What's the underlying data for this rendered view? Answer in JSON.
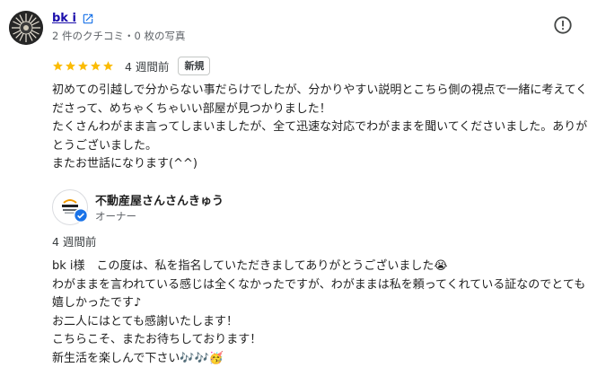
{
  "review": {
    "reviewer_name": "bk i",
    "reviewer_meta": "2 件のクチコミ・0 枚の写真",
    "rating": 5,
    "date": "4 週間前",
    "badge": "新規",
    "text": "初めての引越しで分からない事だらけでしたが、分かりやすい説明とこちら側の視点で一緒に考えてくださって、めちゃくちゃいい部屋が見つかりました！\nたくさんわがまま言ってしまいましたが、全て迅速な対応でわがままを聞いてくださいました。ありがとうございました。\nまたお世話になります(^^)"
  },
  "reply": {
    "owner_name": "不動産屋さんさんきゅう",
    "owner_role": "オーナー",
    "date": "4 週間前",
    "text": "bk i様　この度は、私を指名していただきましてありがとうございました😭\nわがままを言われている感じは全くなかったですが、わがままは私を頼ってくれている証なのでとても嬉しかったです♪\nお二人にはとても感謝いたします！\nこちらこそ、またお待ちしております！\n新生活を楽しんで下さい🎶🎶🥳"
  },
  "icons": {
    "external_link": "external-link-icon",
    "report": "report-icon",
    "star": "star-icon",
    "verified": "verified-check-icon"
  },
  "colors": {
    "star": "#fbbc04",
    "link": "#1a0dab",
    "verified": "#1a73e8"
  }
}
